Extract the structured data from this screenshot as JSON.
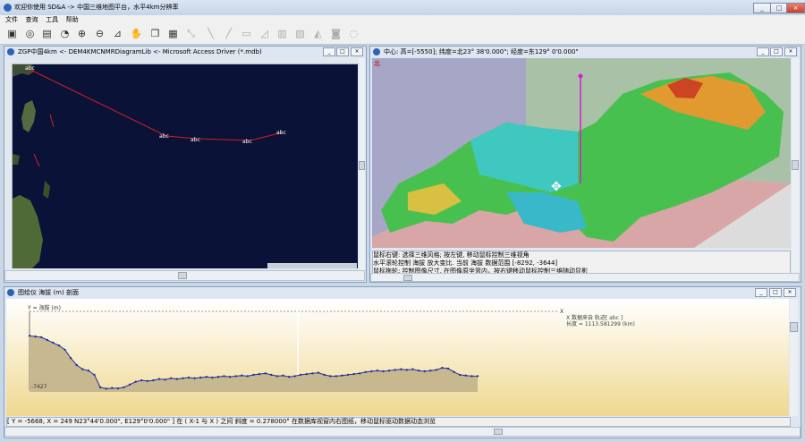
{
  "app": {
    "title": "欢迎你使用 SD&A -> 中国三维地图平台，水平4km分辨率"
  },
  "menu": [
    "文件",
    "查询",
    "工具",
    "帮助"
  ],
  "toolbar": [
    "open-icon",
    "binoculars-icon",
    "print-icon",
    "gauge-icon",
    "zoom-in-icon",
    "zoom-out-icon",
    "measure-icon",
    "pan-icon",
    "copy-icon",
    "layers-icon",
    "select-icon",
    "line-tool-icon",
    "line-tool2-icon",
    "profile-icon",
    "surface-icon",
    "gridline-icon",
    "mesh-icon",
    "terrain-icon",
    "camera-icon"
  ],
  "map_window": {
    "title": "ZGP中国4km <- DEM4KMCNMRDiagramLib <- Microsoft Access Driver (*.mdb)",
    "route_labels": [
      "abc",
      "abc",
      "abc",
      "abc",
      "abc"
    ]
  },
  "view3d_window": {
    "title": "中心: 高=[-5550]; 纬度=北23° 38'0.000\"; 经度=东129° 0'0.000\"",
    "north_label": "北",
    "status_lines": [
      "鼠标右键: 选择三维风格; 按左键, 移动鼠标控制三维视角",
      "水平滚轮控制 海拔 放大变比. 当前 海拔 数据范围 [-8292, -3644]",
      "鼠标拖轮: 控制图像尺寸, 在图像原坐篮内，按右键移动鼠标控制三维随动显影"
    ]
  },
  "profile_window": {
    "title": "图绘仪 海拔 (m) 剖面",
    "y_axis_label": "Y = 海拔 (m)",
    "x_axis_label": "X",
    "legend": [
      "X 数据来自 轨迹[ abc ]",
      "长度 = 1113.581299 (km)"
    ],
    "min_label": "-7427",
    "status": "[ Y = -5668, X = 249 N23°44'0.000\", E129°0'0.000\" ]   在 ( X-1 与 X ) 之间 斜度 = 0.278000°   在数据库视窗内右图纸，移动鼠标驱动数据动态浏览"
  },
  "chart_data": {
    "type": "line",
    "title": "",
    "ylabel": "Y = 海拔 (m)",
    "xlabel": "X",
    "ymin_label": "-7427",
    "values": [
      -3600,
      -3650,
      -3700,
      -3900,
      -4100,
      -4300,
      -4600,
      -5200,
      -5700,
      -6000,
      -6100,
      -6400,
      -7300,
      -7400,
      -7350,
      -7380,
      -7300,
      -7100,
      -6900,
      -6800,
      -6850,
      -6800,
      -6700,
      -6750,
      -6650,
      -6700,
      -6650,
      -6600,
      -6650,
      -6600,
      -6550,
      -6600,
      -6550,
      -6500,
      -6550,
      -6500,
      -6450,
      -6500,
      -6400,
      -6350,
      -6300,
      -6400,
      -6500,
      -6450,
      -6550,
      -6500,
      -6400,
      -6350,
      -6300,
      -6250,
      -6400,
      -6500,
      -6500,
      -6450,
      -6400,
      -6350,
      -6300,
      -6200,
      -6150,
      -6100,
      -6150,
      -6100,
      -6050,
      -6000,
      -6050,
      -6000,
      -6100,
      -6150,
      -6100,
      -6050,
      -5900,
      -5950,
      -6200,
      -6400,
      -6450,
      -6500,
      -6500
    ],
    "ylim": [
      -7500,
      -3000
    ]
  }
}
